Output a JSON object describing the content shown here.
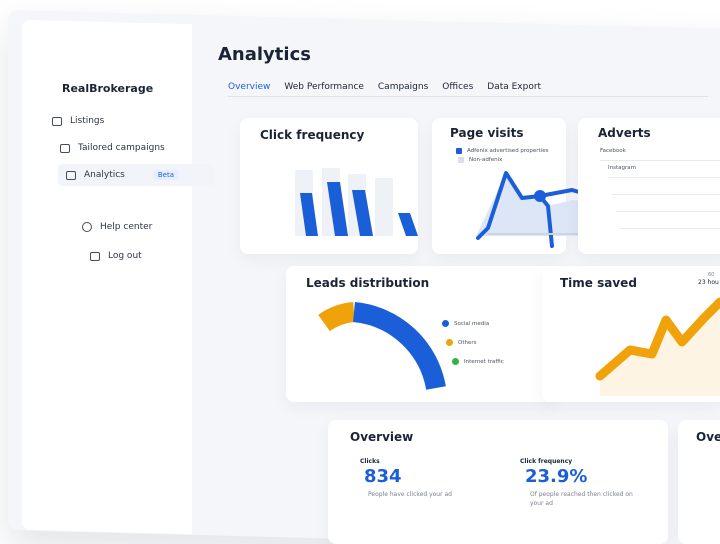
{
  "app": {
    "brand": "RealBrokerage",
    "page_title": "Analytics"
  },
  "sidebar": {
    "items": [
      {
        "label": "Listings",
        "icon": "listings-icon"
      },
      {
        "label": "Tailored campaigns",
        "icon": "campaigns-icon"
      },
      {
        "label": "Analytics",
        "icon": "analytics-icon",
        "badge": "Beta",
        "active": true
      },
      {
        "label": "Help center",
        "icon": "help-icon"
      },
      {
        "label": "Log out",
        "icon": "logout-icon"
      }
    ]
  },
  "tabs": [
    "Overview",
    "Web Performance",
    "Campaigns",
    "Offices",
    "Data Export"
  ],
  "cards": {
    "click_frequency": {
      "title": "Click frequency"
    },
    "page_visits": {
      "title": "Page visits",
      "legend": [
        "Adfenix advertised properties",
        "Non-adfenix"
      ]
    },
    "adverts": {
      "title": "Adverts",
      "rows": [
        "Facebook",
        "Instagram",
        "",
        "",
        ""
      ]
    },
    "leads": {
      "title": "Leads distribution",
      "legend": [
        "Social media",
        "Others",
        "Internet traffic"
      ]
    },
    "time_saved": {
      "title": "Time saved",
      "corner_top": "60",
      "corner_bottom": "23 hou"
    },
    "overview": {
      "title": "Overview",
      "clicks_label": "Clicks",
      "clicks_value": "834",
      "clicks_note": "People have clicked your ad",
      "freq_label": "Click frequency",
      "freq_value": "23.9%",
      "freq_note": "Of people reached then clicked on your ad"
    },
    "overview2": {
      "title": "Ove"
    }
  },
  "colors": {
    "accent_blue": "#1b5fd8",
    "orange": "#f0a20b",
    "green": "#33b347",
    "light_bar": "#eef1f5"
  }
}
